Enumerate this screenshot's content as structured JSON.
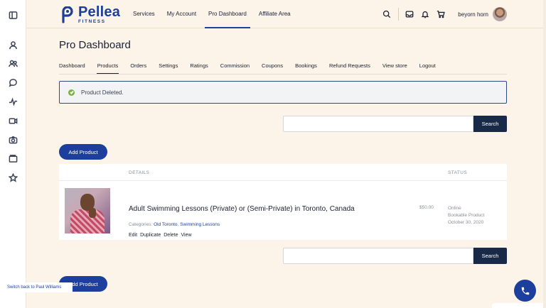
{
  "rail": {
    "icons": [
      "sidebar-toggle-icon",
      "user-icon",
      "group-icon",
      "chat-icon",
      "activity-icon",
      "video-icon",
      "camera-icon",
      "folder-icon",
      "star-icon"
    ]
  },
  "header": {
    "logo_name": "Pellea",
    "logo_sub": "FITNESS",
    "nav": [
      "Services",
      "My Account",
      "Pro Dashboard",
      "Affiliate Area"
    ],
    "active_nav": "Pro Dashboard",
    "user_name": "beyorn horn"
  },
  "page": {
    "title": "Pro Dashboard",
    "tabs": [
      "Dashboard",
      "Products",
      "Orders",
      "Settings",
      "Ratings",
      "Commission",
      "Coupons",
      "Bookings",
      "Refund Requests",
      "View store",
      "Logout"
    ],
    "active_tab": "Products"
  },
  "notice": {
    "message": "Product Deleted."
  },
  "search": {
    "button": "Search",
    "value": ""
  },
  "add_product": {
    "label": "Add Product"
  },
  "table": {
    "headers": {
      "details": "DETAILS",
      "status": "STATUS"
    },
    "rows": [
      {
        "title": "Adult Swimming Lessons (Private) or (Semi-Private) in Toronto, Canada",
        "categories_label": "Categories:",
        "categories": [
          "Old Toronto",
          "Swimming Lessons"
        ],
        "actions": [
          "Edit",
          "Duplicate",
          "Delete",
          "View"
        ],
        "price": "$50.00",
        "status": [
          "Online",
          "Bookable Product",
          "October 30, 2020"
        ]
      }
    ]
  },
  "switch_back": "Switch back to Paul Williams",
  "colors": {
    "brand": "#1c3f9e",
    "search_button": "#182a48",
    "background": "#fcf4e8",
    "success": "#78b23f"
  }
}
